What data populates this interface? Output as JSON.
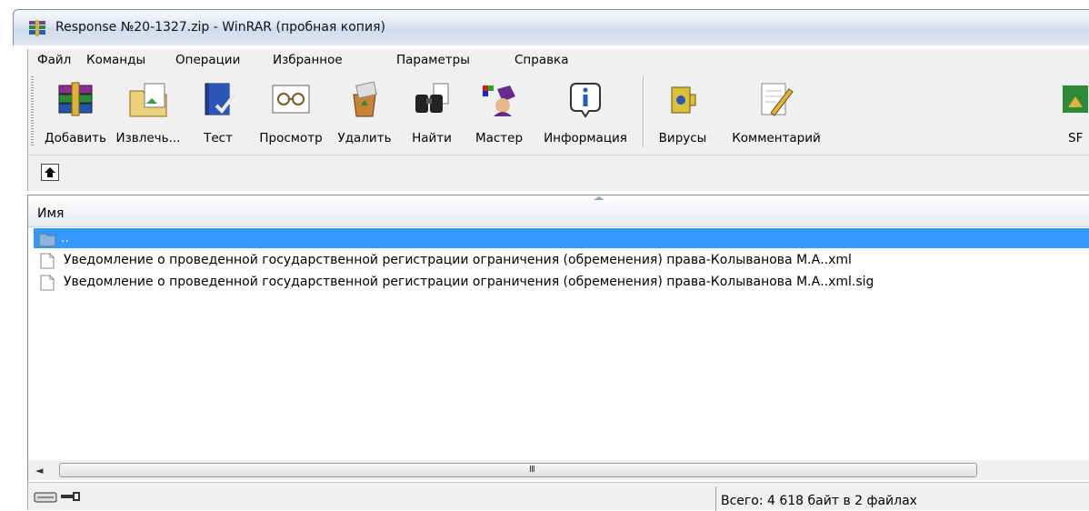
{
  "window": {
    "title": "Response №20-1327.zip - WinRAR (пробная копия)",
    "app_icon": "winrar-books-icon"
  },
  "menu": [
    "Файл",
    "Команды",
    "Операции",
    "Избранное",
    "Параметры",
    "Справка"
  ],
  "toolbar": {
    "buttons": [
      {
        "label": "Добавить",
        "icon": "add-archive-icon"
      },
      {
        "label": "Извлечь...",
        "icon": "extract-folder-icon"
      },
      {
        "label": "Тест",
        "icon": "test-book-icon"
      },
      {
        "label": "Просмотр",
        "icon": "view-glasses-icon"
      },
      {
        "label": "Удалить",
        "icon": "delete-recycle-icon"
      },
      {
        "label": "Найти",
        "icon": "find-binoculars-icon"
      },
      {
        "label": "Мастер",
        "icon": "wizard-icon"
      },
      {
        "label": "Информация",
        "icon": "info-icon"
      },
      {
        "label": "Вирусы",
        "icon": "virus-scan-icon"
      },
      {
        "label": "Комментарий",
        "icon": "comment-pen-icon"
      },
      {
        "label": "SF",
        "icon": "sfx-icon"
      }
    ]
  },
  "address": {
    "up_icon": "up-folder-icon"
  },
  "filelist": {
    "column_name": "Имя",
    "rows": [
      {
        "name": "..",
        "icon": "parent-folder-icon",
        "selected": true
      },
      {
        "name": "Уведомление о проведенной государственной регистрации ограничения (обременения) права-Колыванова М.А..xml",
        "icon": "file-icon",
        "selected": false
      },
      {
        "name": "Уведомление о проведенной государственной регистрации ограничения (обременения) права-Колыванова М.А..xml.sig",
        "icon": "file-icon",
        "selected": false
      }
    ]
  },
  "scrollbar": {
    "left_arrow": "◄",
    "grip": "III"
  },
  "status": {
    "icons": "drive-key-icon",
    "text": "Всего: 4 618 байт в 2 файлах"
  },
  "colors": {
    "selection": "#3399ff",
    "chrome": "#f0f0f0"
  }
}
